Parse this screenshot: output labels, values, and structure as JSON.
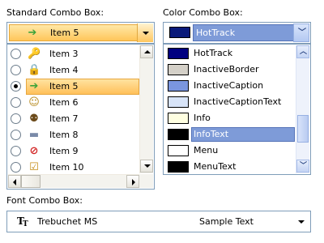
{
  "standard": {
    "caption": "Standard Combo Box:",
    "selected": {
      "label": "Item 5",
      "icon": "puzzle-arrow-icon"
    },
    "items": [
      {
        "label": "Item 3",
        "icon": "key-icon",
        "glyph": "☑",
        "color": "#c9a12a",
        "checked": false
      },
      {
        "label": "Item 4",
        "icon": "lock-icon",
        "glyph": "⬚",
        "color": "#d2a019",
        "checked": false
      },
      {
        "label": "Item 5",
        "icon": "puzzle-arrow-icon",
        "glyph": "➔",
        "color": "#3aa33a",
        "checked": true
      },
      {
        "label": "Item 6",
        "icon": "users-icon",
        "glyph": "☺",
        "color": "#b78b20",
        "checked": false
      },
      {
        "label": "Item 7",
        "icon": "family-icon",
        "glyph": "⚉",
        "color": "#6b4a1a",
        "checked": false
      },
      {
        "label": "Item 8",
        "icon": "drive-icon",
        "glyph": "▬",
        "color": "#7a8aa8",
        "checked": false
      },
      {
        "label": "Item 9",
        "icon": "no-entry-icon",
        "glyph": "⊘",
        "color": "#d22222",
        "checked": false
      },
      {
        "label": "Item 10",
        "icon": "checklist-icon",
        "glyph": "☑",
        "color": "#c48a12",
        "checked": false
      }
    ]
  },
  "color": {
    "caption": "Color Combo Box:",
    "selected": {
      "label": "HotTrack",
      "swatch": "#0a1a7a"
    },
    "items": [
      {
        "label": "HotTrack",
        "swatch": "#000080"
      },
      {
        "label": "InactiveBorder",
        "swatch": "#d4d0c8"
      },
      {
        "label": "InactiveCaption",
        "swatch": "#7a96df"
      },
      {
        "label": "InactiveCaptionText",
        "swatch": "#d8e4f8"
      },
      {
        "label": "Info",
        "swatch": "#ffffe1"
      },
      {
        "label": "InfoText",
        "swatch": "#000000",
        "selected": true
      },
      {
        "label": "Menu",
        "swatch": "#ffffff"
      },
      {
        "label": "MenuText",
        "swatch": "#000000"
      }
    ]
  },
  "font": {
    "caption": "Font Combo Box:",
    "font_name": "Trebuchet MS",
    "sample": "Sample Text",
    "icon": "truetype-font-icon"
  }
}
